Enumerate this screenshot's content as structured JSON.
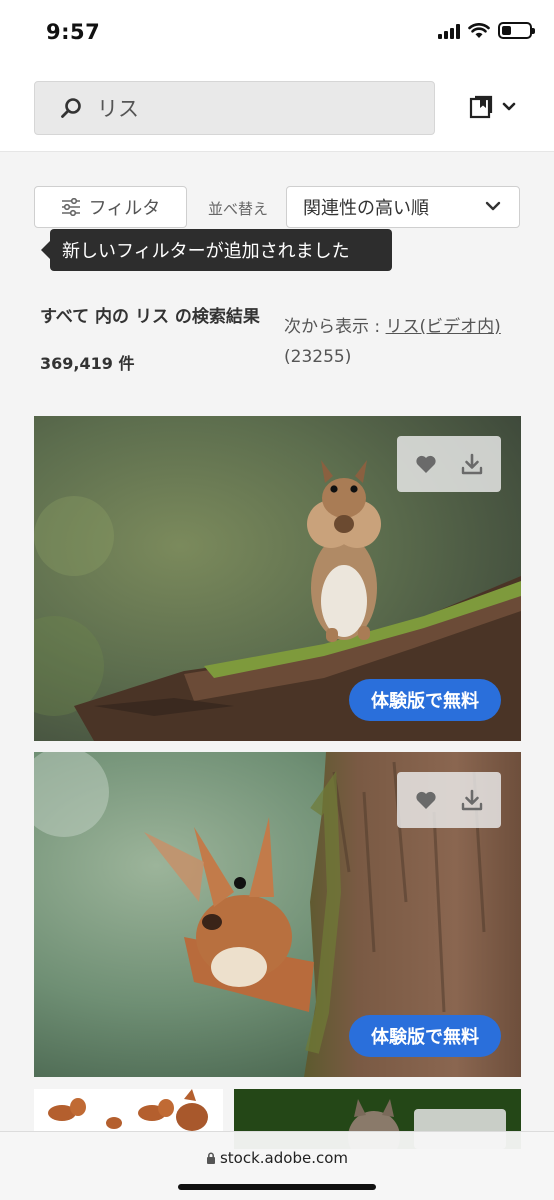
{
  "status": {
    "time": "9:57",
    "battery_fraction": 0.35
  },
  "search": {
    "value": "リス",
    "icon": "search-icon"
  },
  "header": {
    "collections_icon": "collections-icon"
  },
  "filter": {
    "label": "フィルタ",
    "icon": "sliders-icon"
  },
  "sort": {
    "label": "並べ替え",
    "selected": "関連性の高い順"
  },
  "tooltip": {
    "text": "新しいフィルターが追加されました"
  },
  "results": {
    "title": "すべて 内の リス の検索結果",
    "count": "369,419 件",
    "see_also_prefix": "次から表示 : ",
    "see_also_link": "リス(ビデオ内)",
    "see_also_count": "(23255)"
  },
  "cards": [
    {
      "subject": "chipmunk on log",
      "trial_label": "体験版で無料"
    },
    {
      "subject": "red squirrel peeking behind tree",
      "trial_label": "体験版で無料"
    }
  ],
  "browser": {
    "url": "stock.adobe.com"
  },
  "colors": {
    "accent": "#2a6fdb",
    "tooltip_bg": "#2d2d2d"
  }
}
